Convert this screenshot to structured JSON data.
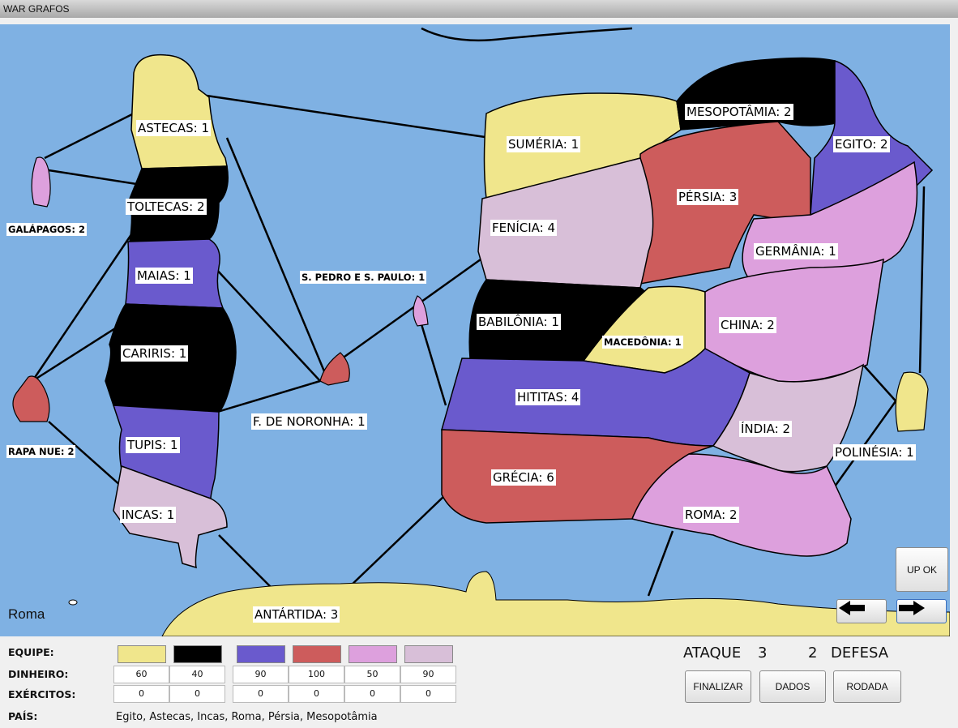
{
  "window": {
    "title": "WAR GRAFOS"
  },
  "map": {
    "territories": [
      {
        "key": "astecas",
        "label": "ASTECAS: 1",
        "color": "#f0e68c"
      },
      {
        "key": "toltecas",
        "label": "TOLTECAS: 2",
        "color": "#000000"
      },
      {
        "key": "maias",
        "label": "MAIAS: 1",
        "color": "#6a5acd"
      },
      {
        "key": "cariris",
        "label": "CARIRIS: 1",
        "color": "#000000"
      },
      {
        "key": "tupis",
        "label": "TUPIS: 1",
        "color": "#6a5acd"
      },
      {
        "key": "incas",
        "label": "INCAS: 1",
        "color": "#d8bfd8"
      },
      {
        "key": "galapagos",
        "label": "GALÁPAGOS: 2",
        "color": "#dda0dd"
      },
      {
        "key": "rapanue",
        "label": "RAPA NUE: 2",
        "color": "#cd5c5c"
      },
      {
        "key": "spedro",
        "label": "S. PEDRO E S. PAULO: 1",
        "color": "#dda0dd"
      },
      {
        "key": "noronha",
        "label": "F. DE NORONHA: 1",
        "color": "#cd5c5c"
      },
      {
        "key": "sumeria",
        "label": "SUMÉRIA: 1",
        "color": "#f0e68c"
      },
      {
        "key": "mesopotamia",
        "label": "MESOPOTÂMIA: 2",
        "color": "#000000"
      },
      {
        "key": "egito",
        "label": "EGITO: 2",
        "color": "#6a5acd"
      },
      {
        "key": "persia",
        "label": "PÉRSIA: 3",
        "color": "#cd5c5c"
      },
      {
        "key": "fenicia",
        "label": "FENÍCIA: 4",
        "color": "#d8bfd8"
      },
      {
        "key": "germania",
        "label": "GERMÂNIA: 1",
        "color": "#dda0dd"
      },
      {
        "key": "babilonia",
        "label": "BABILÔNIA: 1",
        "color": "#000000"
      },
      {
        "key": "macedonia",
        "label": "MACEDÔNIA: 1",
        "color": "#f0e68c"
      },
      {
        "key": "china",
        "label": "CHINA: 2",
        "color": "#dda0dd"
      },
      {
        "key": "hititas",
        "label": "HITITAS: 4",
        "color": "#6a5acd"
      },
      {
        "key": "india",
        "label": "ÍNDIA: 2",
        "color": "#d8bfd8"
      },
      {
        "key": "polinesia",
        "label": "POLINÉSIA: 1",
        "color": "#f0e68c"
      },
      {
        "key": "grecia",
        "label": "GRÉCIA: 6",
        "color": "#cd5c5c"
      },
      {
        "key": "roma",
        "label": "ROMA: 2",
        "color": "#dda0dd"
      },
      {
        "key": "antartida",
        "label": "ANTÁRTIDA: 3",
        "color": "#f0e68c"
      }
    ],
    "current_player": "Roma"
  },
  "controls": {
    "up_ok": "UP OK",
    "prev_icon": "left-arrow-icon",
    "next_icon": "right-arrow-icon",
    "finalizar": "FINALIZAR",
    "dados": "DADOS",
    "rodada": "RODADA",
    "ataque_label": "ATAQUE",
    "ataque_value": "3",
    "defesa_value": "2",
    "defesa_label": "DEFESA"
  },
  "panel": {
    "equipe_label": "EQUIPE:",
    "dinheiro_label": "DINHEIRO:",
    "exercitos_label": "EXÉRCITOS:",
    "pais_label": "PAÍS:",
    "teams": [
      {
        "color": "#f0e68c",
        "dinheiro": "60",
        "exercitos": "0"
      },
      {
        "color": "#000000",
        "dinheiro": "40",
        "exercitos": "0"
      },
      {
        "color": "#6a5acd",
        "dinheiro": "90",
        "exercitos": "0"
      },
      {
        "color": "#cd5c5c",
        "dinheiro": "100",
        "exercitos": "0"
      },
      {
        "color": "#dda0dd",
        "dinheiro": "50",
        "exercitos": "0"
      },
      {
        "color": "#d8bfd8",
        "dinheiro": "90",
        "exercitos": "0"
      }
    ],
    "paises": "Egito, Astecas, Incas, Roma, Pérsia, Mesopotâmia"
  }
}
